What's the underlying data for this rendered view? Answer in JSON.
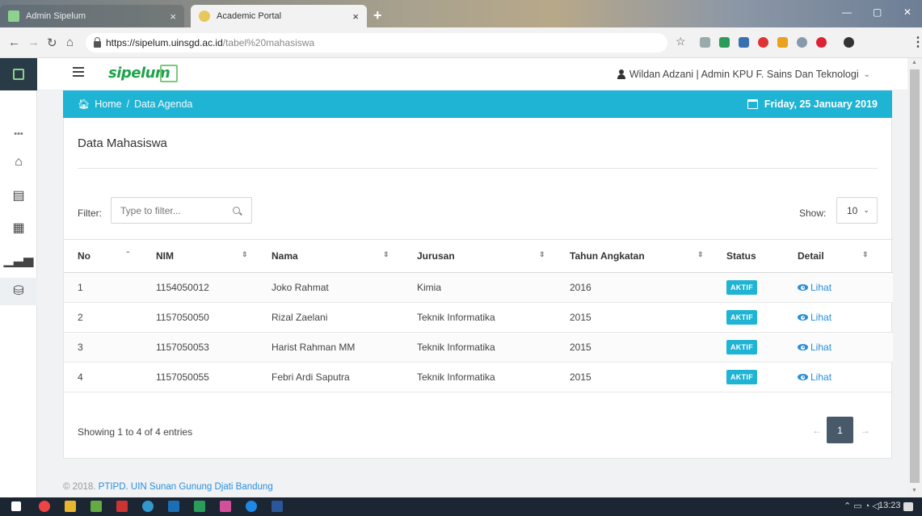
{
  "browser": {
    "tabs": [
      {
        "title": "Admin Sipelum",
        "active": false
      },
      {
        "title": "Academic Portal",
        "active": true
      }
    ],
    "url_host": "https://sipelum.uinsgd.ac.id",
    "url_path": "/tabel%20mahasiswa"
  },
  "header": {
    "brand": "sipelum",
    "user": "Wildan Adzani | Admin KPU F. Sains Dan Teknologi"
  },
  "breadcrumb": {
    "home": "Home",
    "separator": "/",
    "current": "Data Agenda",
    "date": "Friday, 25 January 2019"
  },
  "card": {
    "title": "Data Mahasiswa",
    "filter_label": "Filter:",
    "filter_placeholder": "Type to filter...",
    "show_label": "Show:",
    "show_value": "10"
  },
  "table": {
    "headers": [
      "No",
      "NIM",
      "Nama",
      "Jurusan",
      "Tahun Angkatan",
      "Status",
      "Detail"
    ],
    "rows": [
      {
        "no": "1",
        "nim": "1154050012",
        "nama": "Joko Rahmat",
        "jurusan": "Kimia",
        "tahun": "2016",
        "status": "AKTIF",
        "detail": "Lihat"
      },
      {
        "no": "2",
        "nim": "1157050050",
        "nama": "Rizal Zaelani",
        "jurusan": "Teknik Informatika",
        "tahun": "2015",
        "status": "AKTIF",
        "detail": "Lihat"
      },
      {
        "no": "3",
        "nim": "1157050053",
        "nama": "Harist Rahman MM",
        "jurusan": "Teknik Informatika",
        "tahun": "2015",
        "status": "AKTIF",
        "detail": "Lihat"
      },
      {
        "no": "4",
        "nim": "1157050055",
        "nama": "Febri Ardi Saputra",
        "jurusan": "Teknik Informatika",
        "tahun": "2015",
        "status": "AKTIF",
        "detail": "Lihat"
      }
    ]
  },
  "pagination": {
    "summary": "Showing 1 to 4 of 4 entries",
    "prev": "←",
    "current": "1",
    "next": "→"
  },
  "footer": {
    "copyright": "© 2018.",
    "link": "PTIPD. UIN Sunan Gunung Djati Bandung"
  },
  "taskbar": {
    "time": "13:23"
  },
  "colors": {
    "accent": "#1fb3d4",
    "brand_green": "#1ea34a",
    "link": "#2a8fd9",
    "pager_active": "#485a69"
  }
}
